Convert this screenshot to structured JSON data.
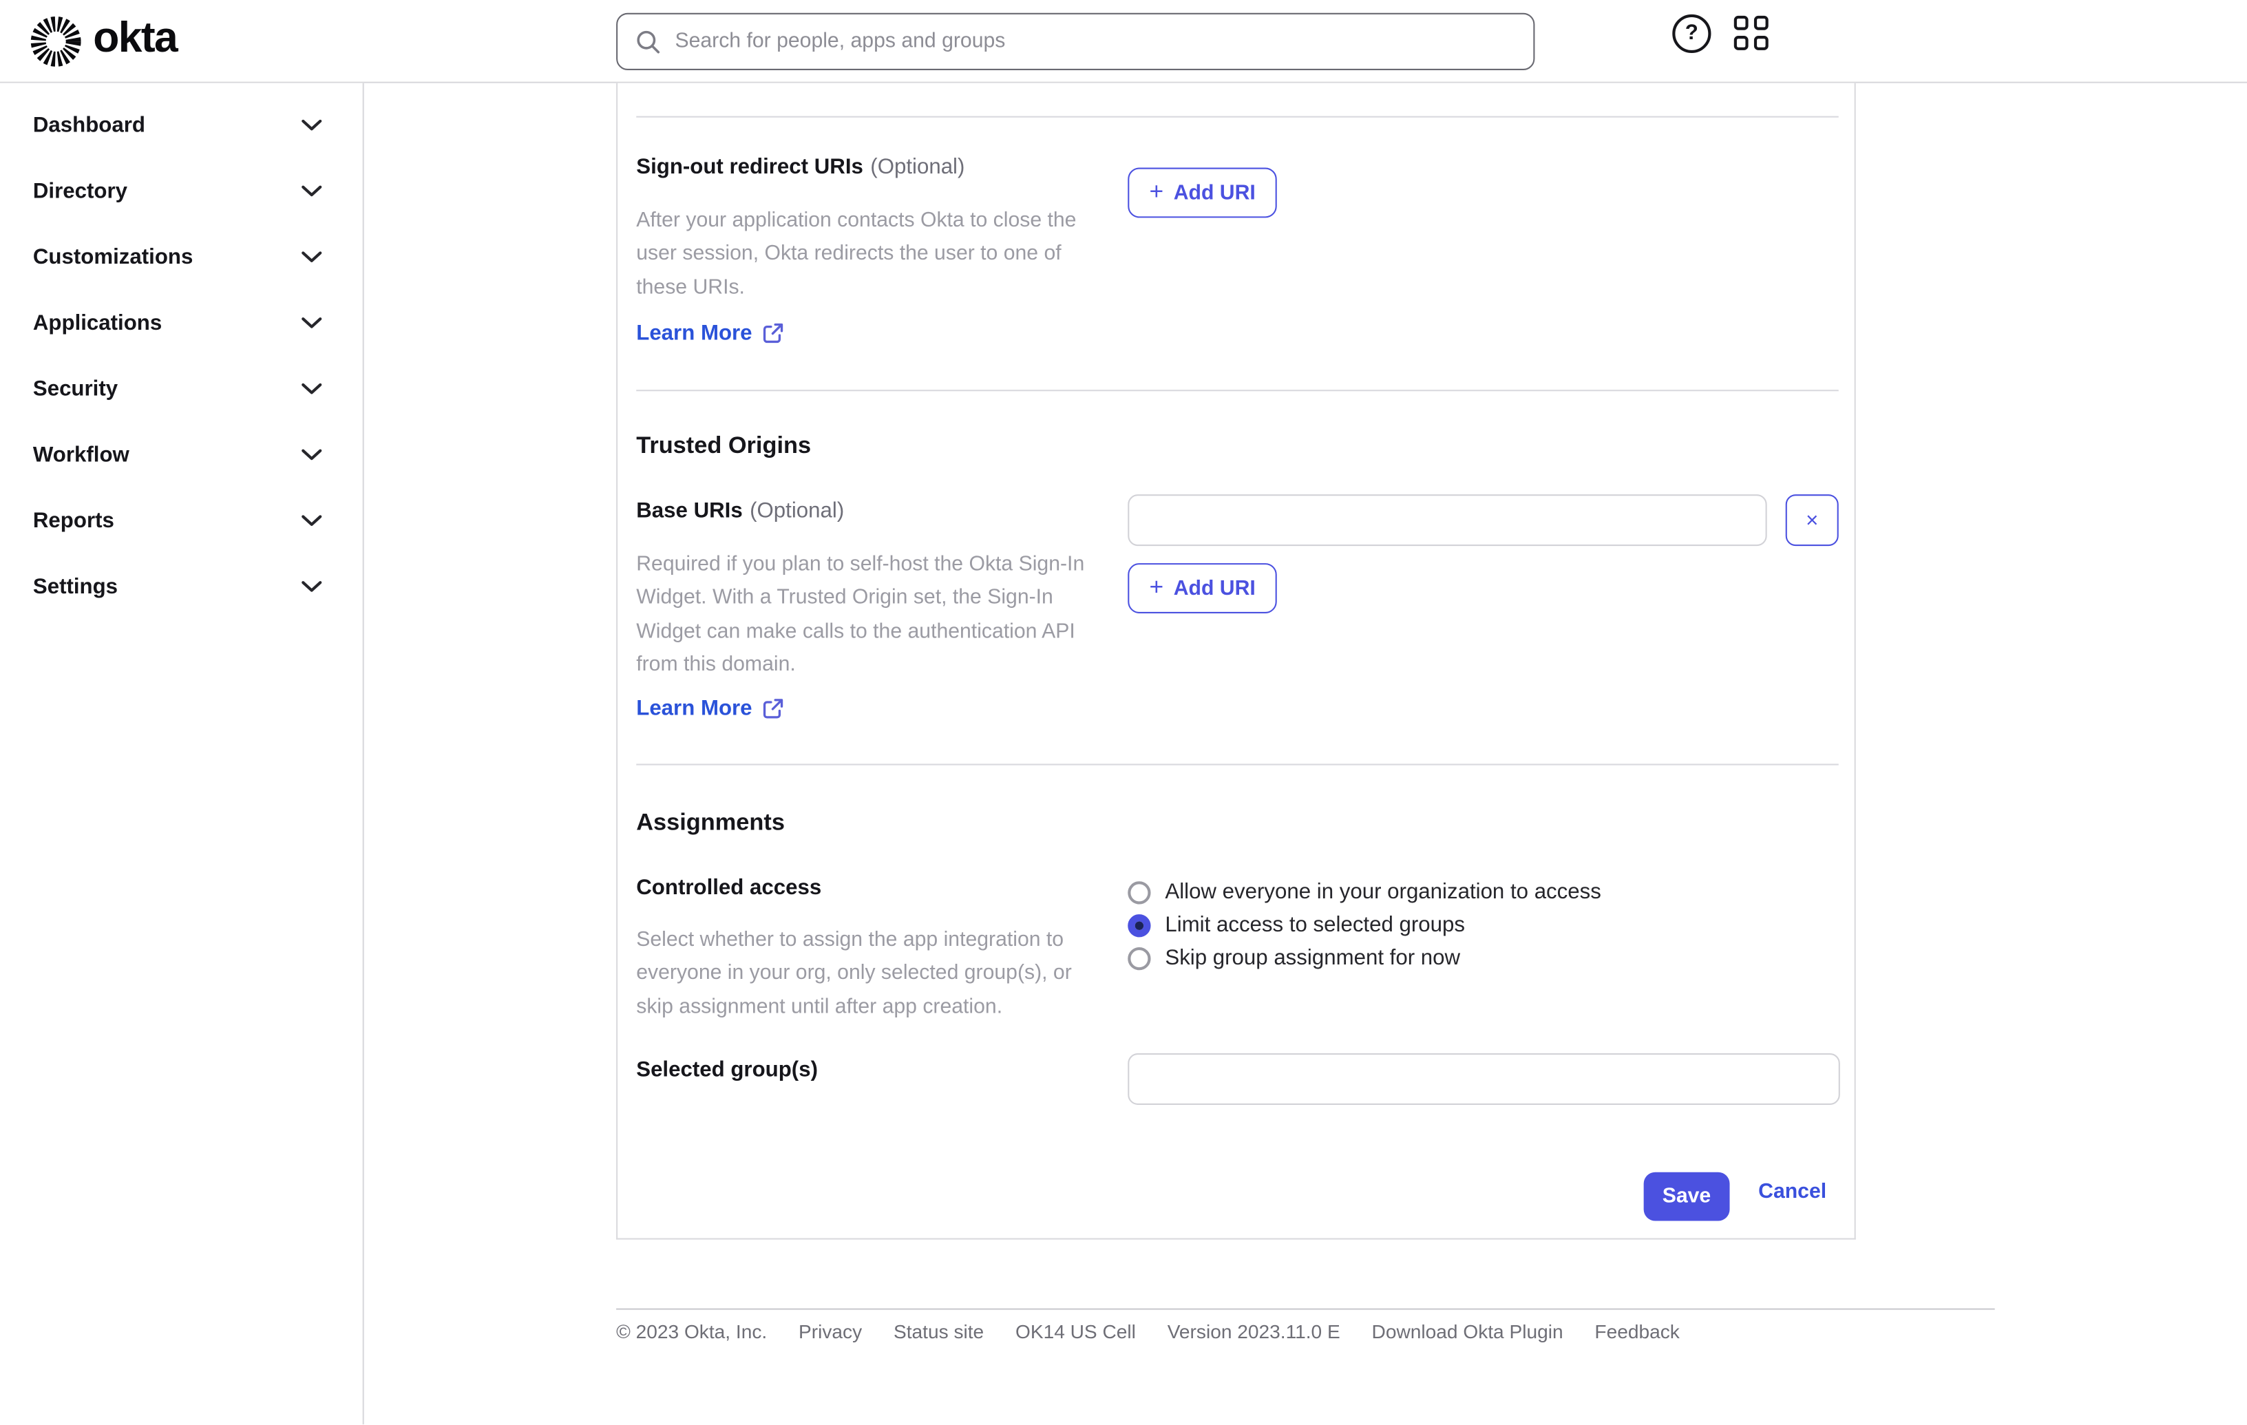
{
  "header": {
    "brand": "okta",
    "search_placeholder": "Search for people, apps and groups"
  },
  "icons": {
    "plus": "+",
    "close": "×",
    "help": "?"
  },
  "colors": {
    "accent": "#4b51e0",
    "link": "#2a52d9",
    "radio_selected": "#4b51e0",
    "text": "#16161b",
    "muted": "#9b9ba3",
    "border": "#d8d8dc"
  },
  "sidebar": {
    "items": [
      {
        "label": "Dashboard"
      },
      {
        "label": "Directory"
      },
      {
        "label": "Customizations"
      },
      {
        "label": "Applications"
      },
      {
        "label": "Security"
      },
      {
        "label": "Workflow"
      },
      {
        "label": "Reports"
      },
      {
        "label": "Settings"
      }
    ]
  },
  "main": {
    "signout": {
      "label": "Sign-out redirect URIs",
      "optional": "(Optional)",
      "description": "After your application contacts Okta to close the user session, Okta redirects the user to one of these URIs.",
      "learn_more": "Learn More",
      "add_uri": "Add URI"
    },
    "trusted_origins": {
      "heading": "Trusted Origins",
      "base_uris_label": "Base URIs",
      "optional": "(Optional)",
      "input_value": "",
      "description": "Required if you plan to self-host the Okta Sign-In Widget. With a Trusted Origin set, the Sign-In Widget can make calls to the authentication API from this domain.",
      "learn_more": "Learn More",
      "add_uri": "Add URI"
    },
    "assignments": {
      "heading": "Assignments",
      "controlled_access_label": "Controlled access",
      "description": "Select whether to assign the app integration to everyone in your org, only selected group(s), or skip assignment until after app creation.",
      "options": [
        {
          "label": "Allow everyone in your organization to access",
          "selected": false
        },
        {
          "label": "Limit access to selected groups",
          "selected": true
        },
        {
          "label": "Skip group assignment for now",
          "selected": false
        }
      ],
      "selected_groups_label": "Selected group(s)",
      "selected_groups_value": ""
    },
    "actions": {
      "save": "Save",
      "cancel": "Cancel"
    }
  },
  "footer": {
    "items": [
      "© 2023 Okta, Inc.",
      "Privacy",
      "Status site",
      "OK14 US Cell",
      "Version 2023.11.0 E",
      "Download Okta Plugin",
      "Feedback"
    ]
  }
}
